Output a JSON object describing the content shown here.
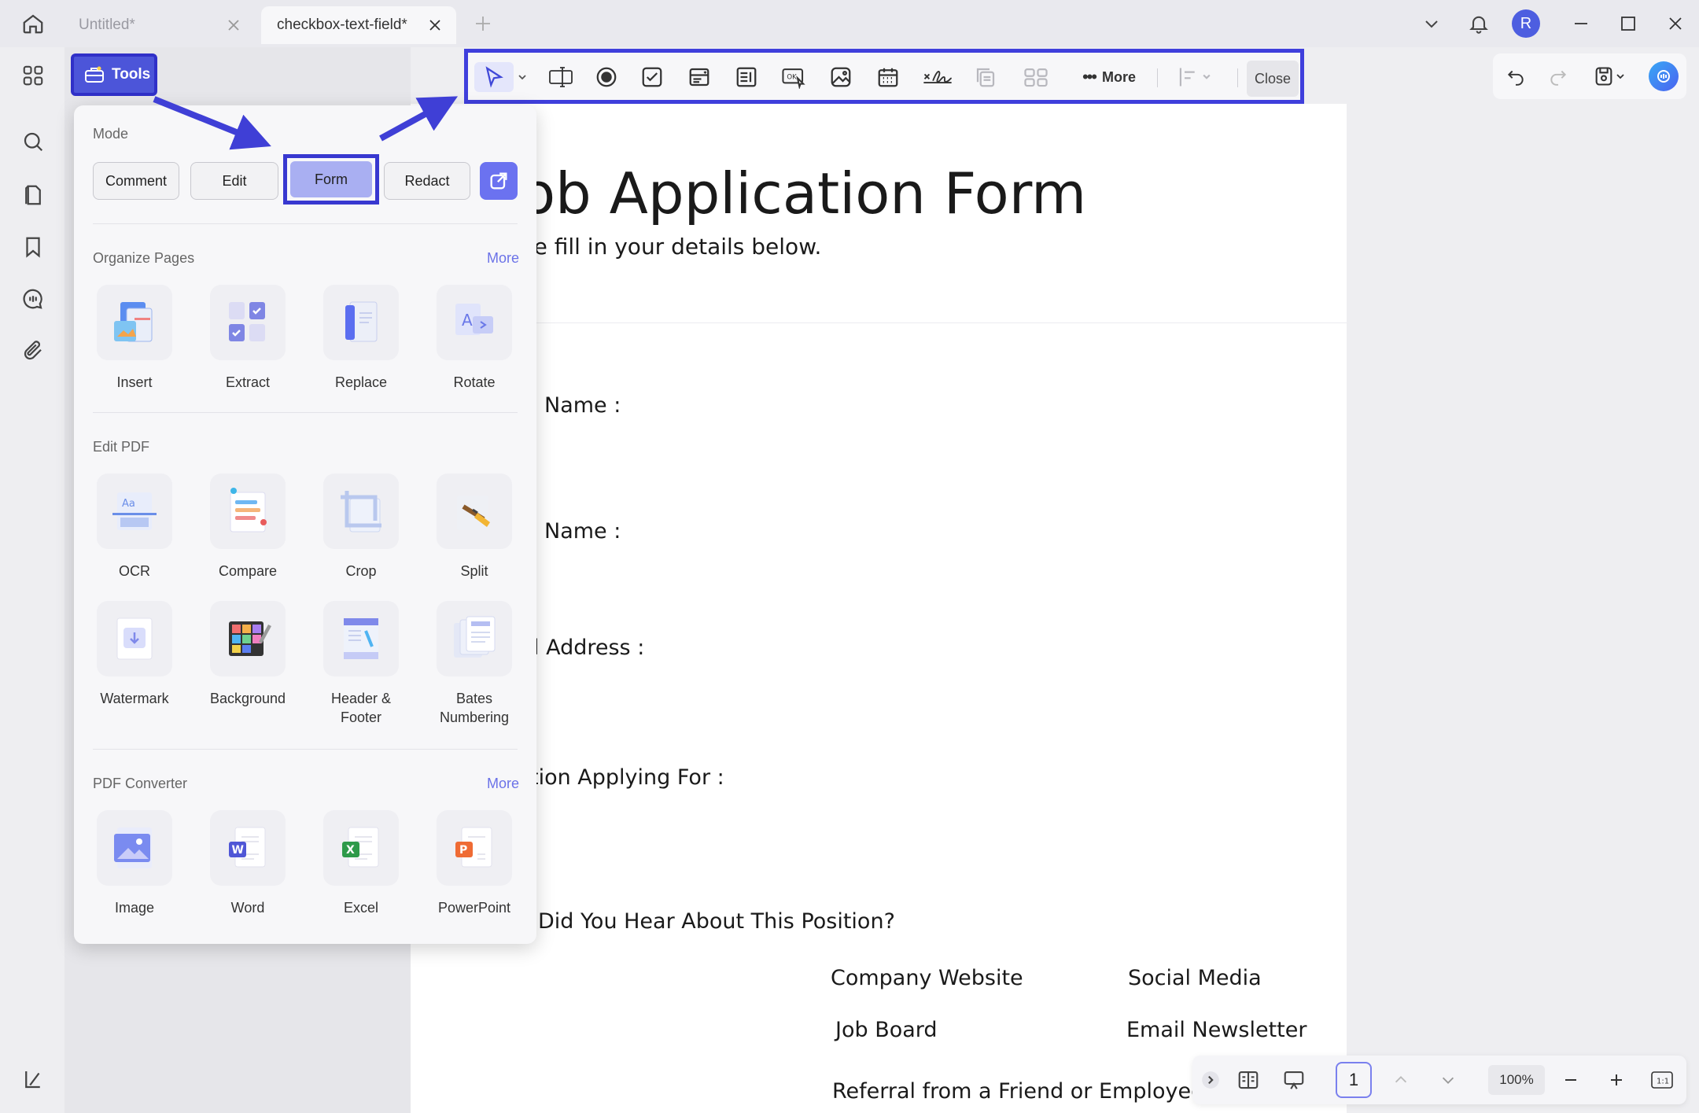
{
  "tabs": [
    {
      "label": "Untitled*",
      "active": false
    },
    {
      "label": "checkbox-text-field*",
      "active": true
    }
  ],
  "user": {
    "avatar_initial": "R"
  },
  "tools_button": {
    "label": "Tools"
  },
  "toolbar": {
    "more_label": "More",
    "close_label": "Close"
  },
  "panel": {
    "mode": {
      "title": "Mode",
      "buttons": [
        "Comment",
        "Edit",
        "Form",
        "Redact"
      ],
      "selected": "Form"
    },
    "sections": [
      {
        "title": "Organize Pages",
        "more": "More",
        "items": [
          "Insert",
          "Extract",
          "Replace",
          "Rotate"
        ]
      },
      {
        "title": "Edit PDF",
        "more": "",
        "items": [
          "OCR",
          "Compare",
          "Crop",
          "Split",
          "Watermark",
          "Background",
          "Header & Footer",
          "Bates Numbering"
        ]
      },
      {
        "title": "PDF Converter",
        "more": "More",
        "items": [
          "Image",
          "Word",
          "Excel",
          "PowerPoint"
        ]
      }
    ]
  },
  "document": {
    "title": "ob Application Form",
    "subtitle": "se fill in your details below.",
    "fields": [
      "Name :",
      "Name :",
      "l Address :",
      "tion Applying For :",
      "Did You Hear About This Position?"
    ],
    "options": [
      "Company Website",
      "Social Media",
      "Job Board",
      "Email Newsletter",
      "Referral from a Friend or Employee"
    ]
  },
  "bottom_bar": {
    "page_number": "1",
    "zoom": "100%"
  },
  "colors": {
    "accent": "#3f3fdc",
    "form_selected": "#a9aff2",
    "tools_button": "#4c55d9"
  }
}
